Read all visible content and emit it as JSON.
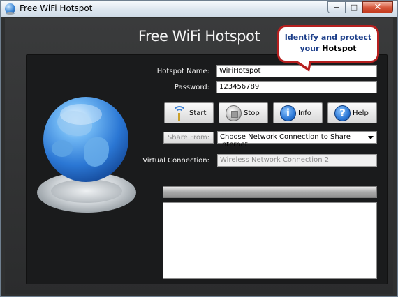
{
  "window": {
    "title": "Free WiFi Hotspot",
    "controls": {
      "minimize": "‒",
      "maximize": "□",
      "close": "✕"
    }
  },
  "app": {
    "heading": "Free WiFi Hotspot"
  },
  "callout": {
    "line1": "Identify and protect",
    "line2_prefix": "your ",
    "line2_emphasis": "Hotspot"
  },
  "form": {
    "hotspot_name_label": "Hotspot Name:",
    "hotspot_name_value": "WiFiHotspot",
    "password_label": "Password:",
    "password_value": "123456789",
    "share_from_button": "Share From:",
    "share_from_selected": "Choose Network Connection to Share Internet",
    "virtual_connection_label": "Virtual Connection:",
    "virtual_connection_value": "Wireless Network Connection 2"
  },
  "buttons": {
    "start": "Start",
    "stop": "Stop",
    "info": "Info",
    "help": "Help",
    "info_glyph": "i",
    "help_glyph": "?"
  },
  "icons": [
    "app-globe-icon",
    "globe-illustration-icon",
    "wifi-antenna-icon",
    "stop-icon",
    "info-icon",
    "help-icon",
    "dropdown-arrow-icon"
  ],
  "colors": {
    "callout_border": "#b61f1f",
    "callout_text": "#1d3f8a",
    "panel_bg": "#1a1b1c"
  }
}
